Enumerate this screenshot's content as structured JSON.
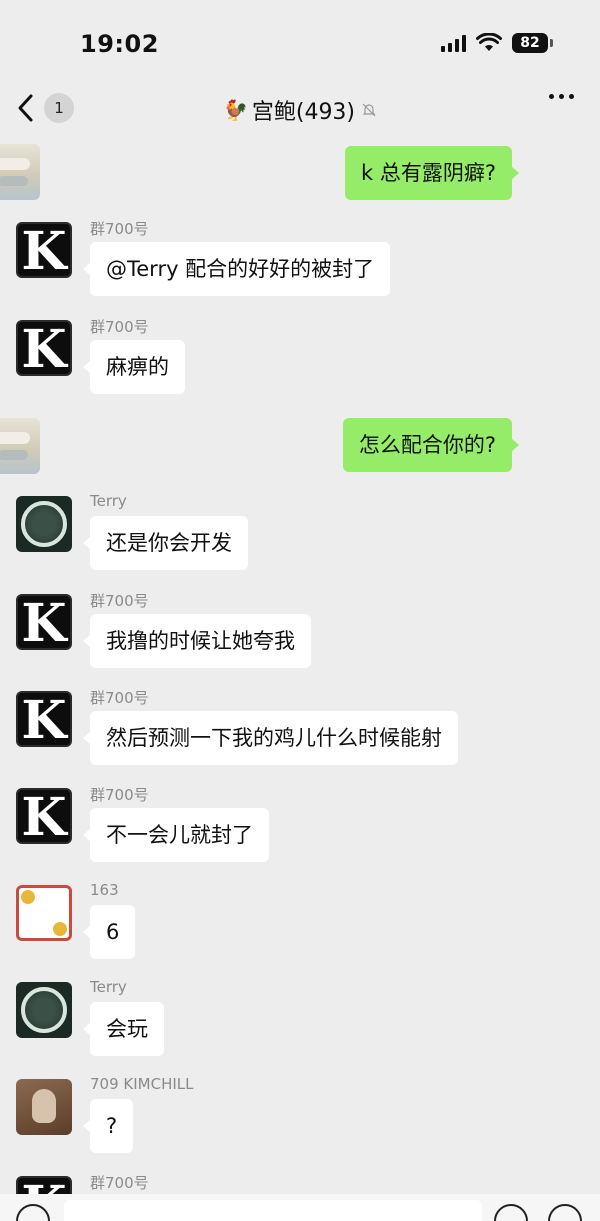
{
  "status_bar": {
    "time": "19:02",
    "battery": "82"
  },
  "nav": {
    "unread_count": "1",
    "title_emoji": "🐓",
    "title": "宫鲍(493)"
  },
  "messages": [
    {
      "side": "right",
      "avatar": "self",
      "text": "k 总有露阴癖?"
    },
    {
      "side": "left",
      "avatar": "k",
      "sender": "群700号",
      "text": "@Terry 配合的好好的被封了"
    },
    {
      "side": "left",
      "avatar": "k",
      "sender": "群700号",
      "text": "麻痹的"
    },
    {
      "side": "right",
      "avatar": "self",
      "text": "怎么配合你的?"
    },
    {
      "side": "left",
      "avatar": "terry",
      "sender": "Terry",
      "text": "还是你会开发"
    },
    {
      "side": "left",
      "avatar": "k",
      "sender": "群700号",
      "text": "我撸的时候让她夸我"
    },
    {
      "side": "left",
      "avatar": "k",
      "sender": "群700号",
      "text": "然后预测一下我的鸡儿什么时候能射"
    },
    {
      "side": "left",
      "avatar": "k",
      "sender": "群700号",
      "text": "不一会儿就封了"
    },
    {
      "side": "left",
      "avatar": "163",
      "sender": "163",
      "text": "6"
    },
    {
      "side": "left",
      "avatar": "terry",
      "sender": "Terry",
      "text": "会玩"
    },
    {
      "side": "left",
      "avatar": "kim",
      "sender": "709 KIMCHILL",
      "text": "?"
    },
    {
      "side": "left",
      "avatar": "k",
      "sender": "群700号",
      "text": ""
    }
  ]
}
